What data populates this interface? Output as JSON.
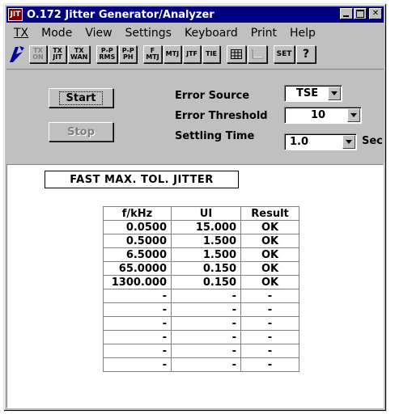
{
  "window": {
    "app_icon_label": "JIT",
    "title": "O.172 Jitter Generator/Analyzer",
    "controls": [
      "minimize-icon",
      "maximize-icon",
      "close-icon"
    ]
  },
  "menu": [
    "TX",
    "Mode",
    "View",
    "Settings",
    "Keyboard",
    "Print",
    "Help"
  ],
  "toolbar": {
    "logo_icon": "lightning-logo-icon",
    "buttons": [
      {
        "label": "TX\nON",
        "enabled": false
      },
      {
        "label": "TX\nJIT",
        "enabled": true
      },
      {
        "label": "TX\nWAN",
        "enabled": true
      },
      {
        "label": "P-P\nRMS",
        "enabled": true
      },
      {
        "label": "P-P\nPH",
        "enabled": true
      },
      {
        "label": "F\nMTJ",
        "enabled": true
      },
      {
        "label": "MTJ",
        "enabled": true
      },
      {
        "label": "JTF",
        "enabled": true
      },
      {
        "label": "TIE",
        "enabled": true
      },
      {
        "icon": "grid-icon",
        "enabled": true
      },
      {
        "icon": "graph-icon",
        "enabled": false
      },
      {
        "label": "SET",
        "enabled": true
      },
      {
        "icon": "help-question-icon",
        "enabled": true
      }
    ]
  },
  "controls": {
    "start_label": "Start",
    "stop_label": "Stop",
    "error_source_label": "Error Source",
    "error_source_value": "TSE",
    "error_threshold_label": "Error Threshold",
    "error_threshold_value": "10",
    "settling_time_label": "Settling Time",
    "settling_time_value": "1.0",
    "settling_time_unit": "Sec"
  },
  "measurement_mode": "FAST  MAX.  TOL.  JITTER",
  "table": {
    "headers": [
      "f/kHz",
      "UI",
      "Result"
    ],
    "rows": [
      [
        "0.0500",
        "15.000",
        "OK"
      ],
      [
        "0.5000",
        "1.500",
        "OK"
      ],
      [
        "6.5000",
        "1.500",
        "OK"
      ],
      [
        "65.0000",
        "0.150",
        "OK"
      ],
      [
        "1300.000",
        "0.150",
        "OK"
      ],
      [
        "-",
        "-",
        "-"
      ],
      [
        "-",
        "-",
        "-"
      ],
      [
        "-",
        "-",
        "-"
      ],
      [
        "-",
        "-",
        "-"
      ],
      [
        "-",
        "-",
        "-"
      ],
      [
        "-",
        "-",
        "-"
      ]
    ]
  }
}
